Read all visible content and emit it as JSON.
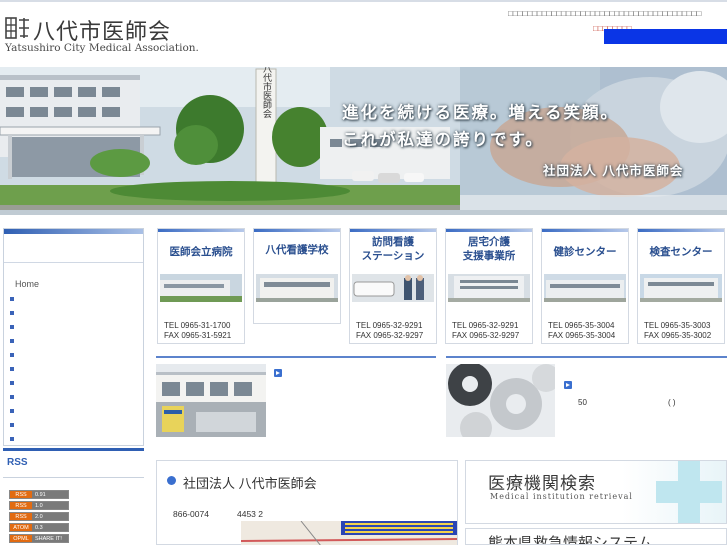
{
  "header": {
    "logo_jp": "八代市医師会",
    "logo_en": "Yatsushiro City Medical Association.",
    "note": "□□□□□□□□□□□□□□□□□□□□□□□□□□□□□□□□□□□□□□□□",
    "link": "□□□□□□□□"
  },
  "banner": {
    "line1": "進化を続ける医療。増える笑顔。",
    "line2": "これが私達の誇りです。",
    "line3": "社団法人 八代市医師会",
    "sign_text": "八代市医師会"
  },
  "sidebar": {
    "items": [
      {
        "label": "Home"
      },
      {
        "label": ""
      },
      {
        "label": ""
      },
      {
        "label": ""
      },
      {
        "label": ""
      },
      {
        "label": ""
      },
      {
        "label": ""
      },
      {
        "label": ""
      },
      {
        "label": ""
      },
      {
        "label": ""
      },
      {
        "label": ""
      },
      {
        "label": ""
      }
    ],
    "rss_title": "RSS",
    "rss_badges": [
      {
        "k": "RSS",
        "v": "0.91"
      },
      {
        "k": "RSS",
        "v": "1.0"
      },
      {
        "k": "RSS",
        "v": "2.0"
      },
      {
        "k": "ATOM",
        "v": "0.3"
      },
      {
        "k": "OPML",
        "v": "SHARE IT!"
      }
    ]
  },
  "cards": [
    {
      "title_1": "医師会立病院",
      "title_2": "",
      "tel": "TEL 0965-31-1700",
      "fax": "FAX 0965-31-5921"
    },
    {
      "title_1": "八代看護学校",
      "title_2": "",
      "tel": "",
      "fax": ""
    },
    {
      "title_1": "訪問看護",
      "title_2": "ステーション",
      "tel": "TEL 0965-32-9291",
      "fax": "FAX 0965-32-9297"
    },
    {
      "title_1": "居宅介護",
      "title_2": "支援事業所",
      "tel": "TEL 0965-32-9291",
      "fax": "FAX 0965-32-9297"
    },
    {
      "title_1": "健診センター",
      "title_2": "",
      "tel": "TEL 0965-35-3004",
      "fax": "FAX 0965-35-3004"
    },
    {
      "title_1": "検査センター",
      "title_2": "",
      "tel": "TEL 0965-35-3003",
      "fax": "FAX 0965-35-3002"
    }
  ],
  "features": {
    "right_text_1": "50",
    "right_text_2": "( )"
  },
  "association": {
    "title": "社団法人 八代市医師会",
    "zip": "866-0074",
    "addr": "4453 2"
  },
  "search": {
    "title": "医療機関検索",
    "subtitle": "Medical institution retrieval"
  },
  "kumamoto": {
    "title": "熊本県救急情報システム"
  }
}
